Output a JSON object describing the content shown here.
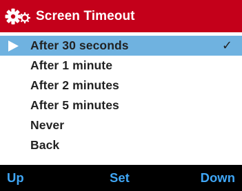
{
  "header": {
    "icon": "gears-icon",
    "title": "Screen Timeout",
    "background_color": "#c4001a"
  },
  "menu": {
    "selected_color": "#6fb2e0",
    "items": [
      {
        "label": "After 30 seconds",
        "selected": true,
        "checked": true,
        "check_mark": "✓"
      },
      {
        "label": "After 1 minute",
        "selected": false,
        "checked": false
      },
      {
        "label": "After 2 minutes",
        "selected": false,
        "checked": false
      },
      {
        "label": "After 5 minutes",
        "selected": false,
        "checked": false
      },
      {
        "label": "Never",
        "selected": false,
        "checked": false
      },
      {
        "label": "Back",
        "selected": false,
        "checked": false
      }
    ]
  },
  "softkeys": {
    "up": "Up",
    "set": "Set",
    "down": "Down",
    "text_color": "#3fa6f5"
  }
}
